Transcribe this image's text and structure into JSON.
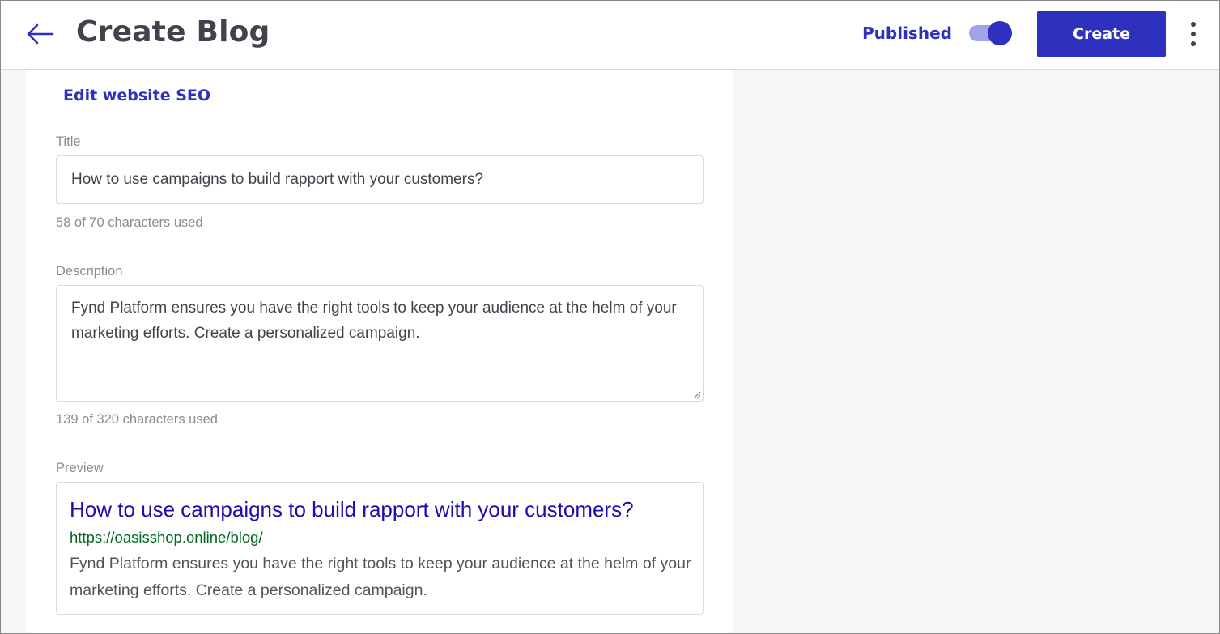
{
  "header": {
    "title": "Create Blog",
    "published_label": "Published",
    "published_on": true,
    "create_label": "Create"
  },
  "seo": {
    "edit_link": "Edit website SEO",
    "title_label": "Title",
    "title_value": "How to use campaigns to build rapport with your customers?",
    "title_count": "58 of 70 characters used",
    "description_label": "Description",
    "description_value": "Fynd Platform ensures you have the right tools to keep your audience at the helm of your marketing efforts. Create a personalized campaign.",
    "description_count": "139 of 320 characters used",
    "preview_label": "Preview",
    "preview": {
      "title": "How to use campaigns to build rapport with your customers?",
      "url": "https://oasisshop.online/blog/",
      "description": "Fynd Platform ensures you have the right tools to keep your audience at the helm of your marketing efforts. Create a personalized campaign."
    }
  },
  "colors": {
    "accent": "#2e31be",
    "toggle_track": "#9fa3e8",
    "preview_title": "#1a0dab",
    "preview_url": "#006621"
  },
  "icons": {
    "back": "arrow-left-icon",
    "menu": "kebab-menu-icon"
  }
}
